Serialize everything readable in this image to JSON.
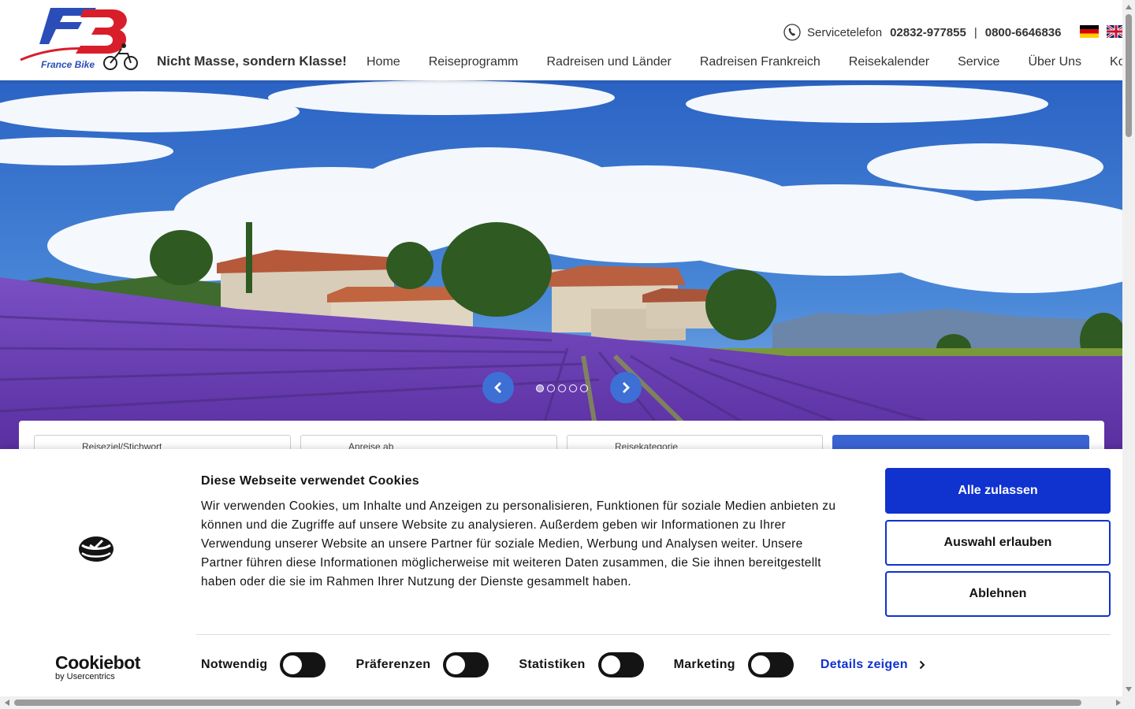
{
  "header": {
    "logo_text": "France Bike",
    "tagline": "Nicht Masse, sondern Klasse!",
    "service_label": "Servicetelefon",
    "phone_1": "02832-977855",
    "phone_separator": "|",
    "phone_2": "0800-6646836",
    "nav": [
      "Home",
      "Reiseprogramm",
      "Radreisen und Länder",
      "Radreisen Frankreich",
      "Reisekalender",
      "Service",
      "Über Uns",
      "Kontakt"
    ]
  },
  "hero": {
    "slides_count": 5,
    "active_slide": 1
  },
  "search": {
    "field_1_label": "Reiseziel/Stichwort",
    "field_2_label": "Anreise ab",
    "field_3_label": "Reisekategorie"
  },
  "cookie": {
    "title": "Diese Webseite verwendet Cookies",
    "text": "Wir verwenden Cookies, um Inhalte und Anzeigen zu personalisieren, Funktionen für soziale Medien anbieten zu können und die Zugriffe auf unsere Website zu analysieren. Außerdem geben wir Informationen zu Ihrer Verwendung unserer Website an unsere Partner für soziale Medien, Werbung und Analysen weiter. Unsere Partner führen diese Informationen möglicherweise mit weiteren Daten zusammen, die Sie ihnen bereitgestellt haben oder die sie im Rahmen Ihrer Nutzung der Dienste gesammelt haben.",
    "btn_allow_all": "Alle zulassen",
    "btn_allow_selection": "Auswahl erlauben",
    "btn_deny": "Ablehnen",
    "brand": "Cookiebot",
    "brand_sub": "by Usercentrics",
    "toggles": [
      "Notwendig",
      "Präferenzen",
      "Statistiken",
      "Marketing"
    ],
    "details_link": "Details zeigen"
  },
  "colors": {
    "accent_blue": "#1032cf",
    "slider_blue": "#3d6fd4",
    "search_button": "#3b64d3"
  }
}
